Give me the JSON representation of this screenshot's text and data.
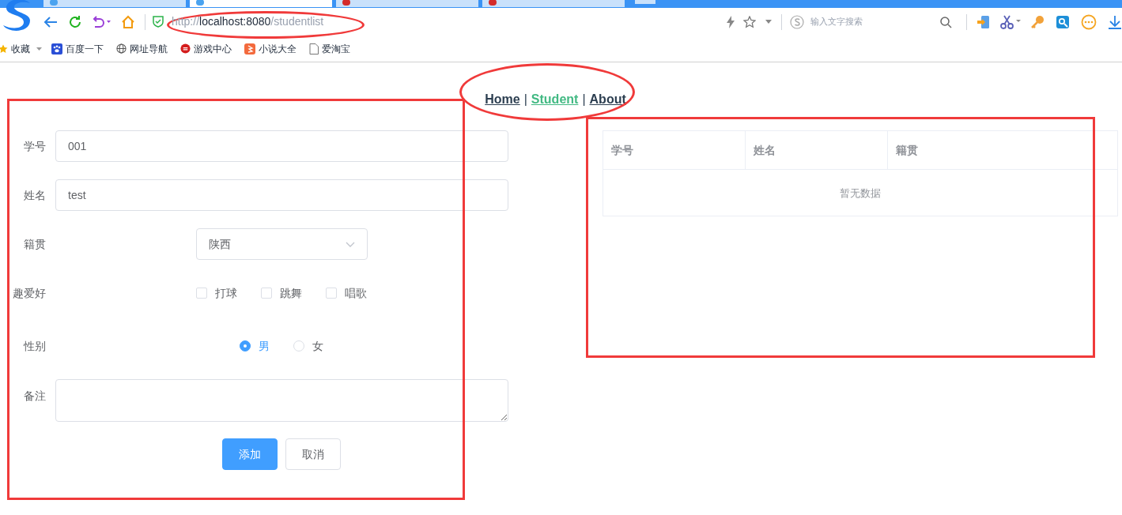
{
  "browser": {
    "tabs": [
      {
        "selected": false
      },
      {
        "selected": true
      },
      {
        "selected": false
      },
      {
        "selected": false
      }
    ],
    "url": {
      "scheme": "http://",
      "host": "localhost:8080",
      "path": "/studentlist"
    },
    "search": {
      "placeholder": "输入文字搜索"
    },
    "bookmarks": [
      {
        "label": "收藏",
        "kind": "favorites"
      },
      {
        "label": "百度一下",
        "kind": "paw"
      },
      {
        "label": "网址导航",
        "kind": "globe"
      },
      {
        "label": "游戏中心",
        "kind": "game"
      },
      {
        "label": "小说大全",
        "kind": "novel"
      },
      {
        "label": "爱淘宝",
        "kind": "page"
      }
    ]
  },
  "nav": {
    "separator": "|",
    "links": [
      {
        "label": "Home",
        "selected": false
      },
      {
        "label": "Student",
        "selected": true
      },
      {
        "label": "About",
        "selected": false
      }
    ]
  },
  "form": {
    "fields": [
      {
        "kind": "text",
        "label": "学号",
        "value": "001"
      },
      {
        "kind": "text",
        "label": "姓名",
        "value": "test"
      },
      {
        "kind": "select",
        "label": "籍贯",
        "value": "陕西"
      },
      {
        "kind": "checkboxes",
        "label": "趣爱好",
        "options": [
          {
            "label": "打球",
            "checked": false
          },
          {
            "label": "跳舞",
            "checked": false
          },
          {
            "label": "唱歌",
            "checked": false
          }
        ]
      },
      {
        "kind": "radios",
        "label": "性别",
        "options": [
          {
            "label": "男",
            "selected": true
          },
          {
            "label": "女",
            "selected": false
          }
        ]
      },
      {
        "kind": "textarea",
        "label": "备注"
      }
    ],
    "buttons": [
      {
        "label": "添加",
        "kind": "primary"
      },
      {
        "label": "取消",
        "kind": "default"
      }
    ]
  },
  "table": {
    "columns": [
      "学号",
      "姓名",
      "籍贯"
    ],
    "empty_text": "暂无数据"
  },
  "annotations": [
    {
      "kind": "ellipse"
    },
    {
      "kind": "ellipse"
    },
    {
      "kind": "rectangle"
    },
    {
      "kind": "rectangle"
    }
  ]
}
